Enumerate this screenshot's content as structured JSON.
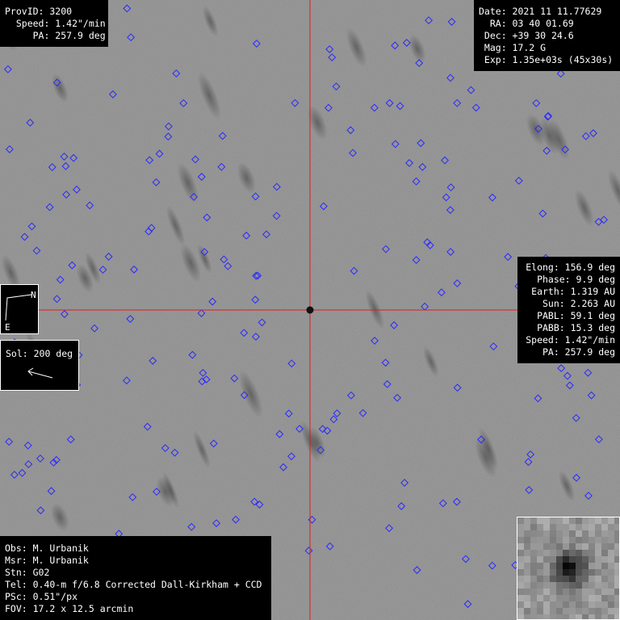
{
  "colors": {
    "crosshair": "#e01e1e",
    "marker": "#2a2aff",
    "panel_bg": "#000000",
    "panel_text": "#ffffff"
  },
  "top_left": [
    "ProvID: 3200",
    "  Speed: 1.42\"/min",
    "     PA: 257.9 deg"
  ],
  "top_right": [
    "Date: 2021 11 11.77629",
    "  RA: 03 40 01.69",
    " Dec: +39 30 24.6",
    " Mag: 17.2 G",
    " Exp: 1.35e+03s (45x30s)"
  ],
  "mid_right": [
    "Elong: 156.9 deg",
    "Phase: 9.9 deg",
    "Earth: 1.319 AU",
    "Sun: 2.263 AU",
    "PABL: 59.1 deg",
    "PABB: 15.3 deg",
    "Speed: 1.42\"/min",
    "PA: 257.9 deg"
  ],
  "bottom_left": [
    "Obs: M. Urbanik",
    "Msr: M. Urbanik",
    "Stn: G02",
    "Tel: 0.40-m f/6.8 Corrected Dall-Kirkham + CCD",
    "PSc: 0.51\"/px",
    "FOV: 17.2 x 12.5 arcmin"
  ],
  "compass": {
    "north": "N",
    "east": "E"
  },
  "sol": {
    "label": "Sol: 200 deg"
  }
}
